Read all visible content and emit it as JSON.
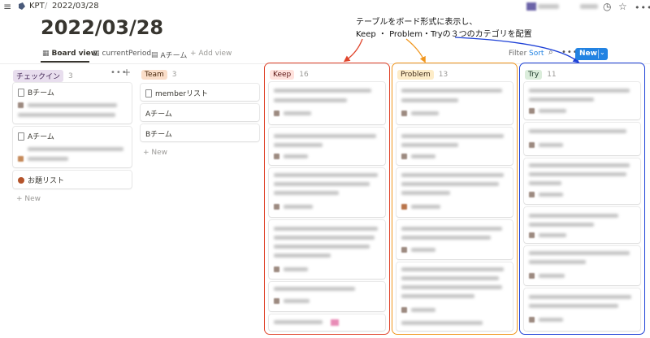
{
  "breadcrumb": {
    "workspace": "KPT",
    "separator": "/",
    "page": "2022/03/28"
  },
  "page_title": "2022/03/28",
  "views": {
    "tabs": [
      {
        "label": "Board view"
      },
      {
        "label": "currentPeriod"
      },
      {
        "label": "Aチーム"
      },
      {
        "label": "+ Add view"
      }
    ],
    "filter_label": "Filter",
    "sort_label": "Sort",
    "new_label": "New"
  },
  "annotation": {
    "line1": "テーブルをボード形式に表示し、",
    "line2": "Keep ・ Problem・Tryの３つのカテゴリを配置"
  },
  "columns": [
    {
      "name": "チェックイン",
      "count": "3",
      "cards": [
        "Bチーム",
        "Aチーム",
        "お題リスト"
      ],
      "new_label": "+ New"
    },
    {
      "name": "Team",
      "count": "3",
      "cards": [
        "memberリスト",
        "Aチーム",
        "Bチーム"
      ],
      "new_label": "+ New"
    },
    {
      "name": "Keep",
      "count": "16"
    },
    {
      "name": "Problem",
      "count": "13"
    },
    {
      "name": "Try",
      "count": "11"
    }
  ],
  "colors": {
    "keep_highlight": "#e0452c",
    "problem_highlight": "#f0961e",
    "try_highlight": "#1c3fd6",
    "accent": "#2383e2"
  }
}
